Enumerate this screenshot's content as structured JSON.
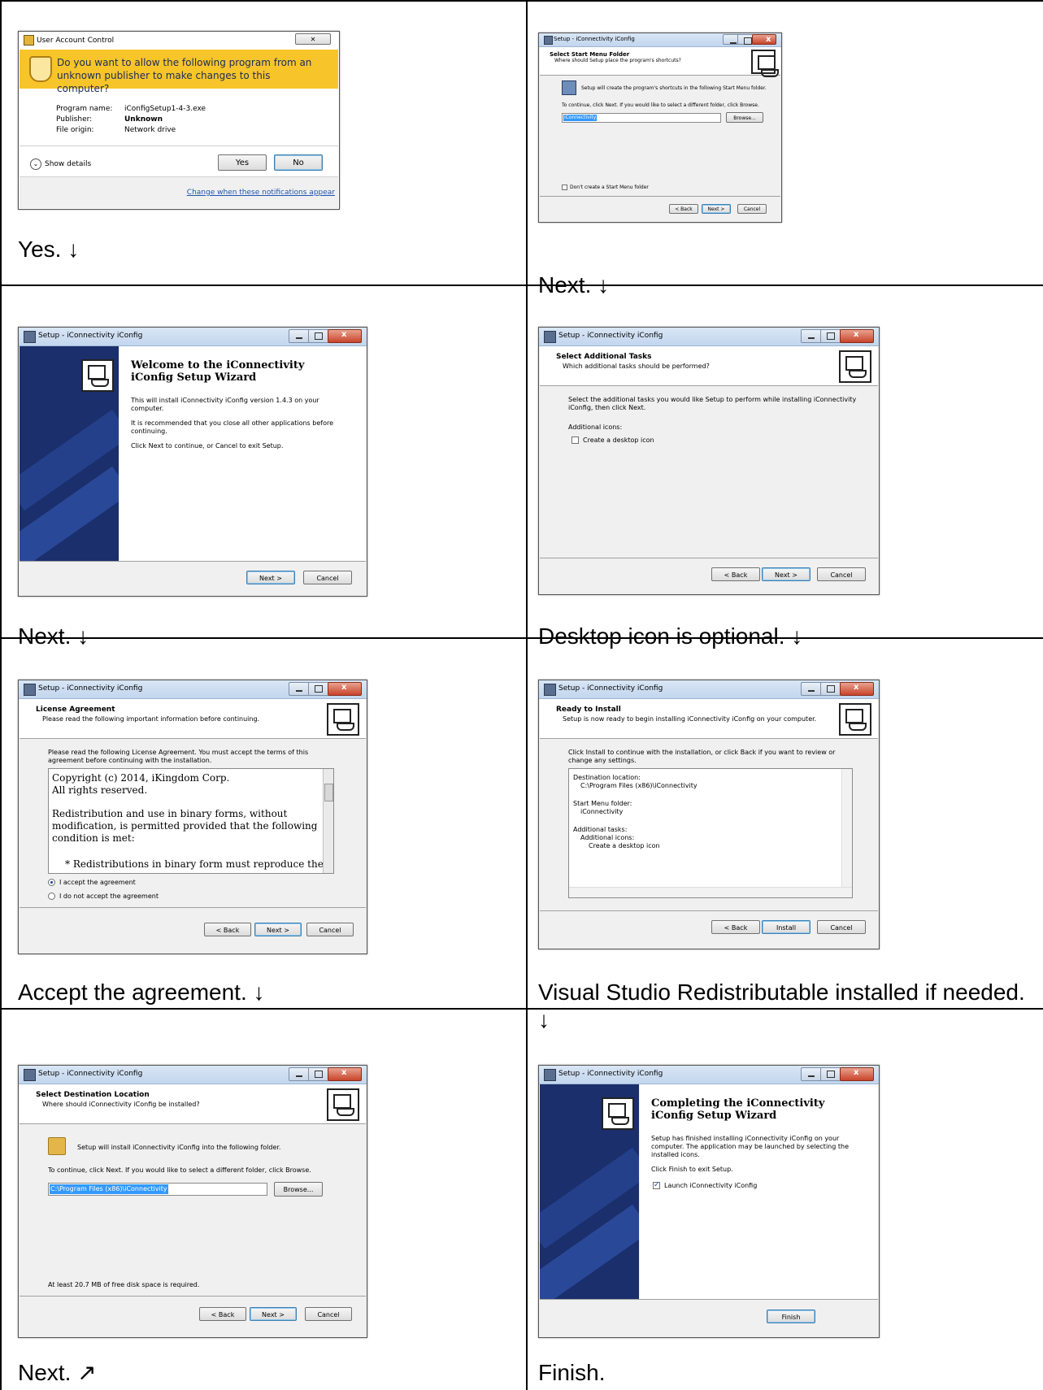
{
  "captions": {
    "c1": "Yes. ↓",
    "c2": "Next. ↓",
    "c3": "Next. ↓",
    "c4": "Desktop icon is optional. ↓",
    "c5": "Accept the agreement. ↓",
    "c6": "Visual Studio Redistributable installed if needed. ↓",
    "c7": "Next. ↗",
    "c8": "Finish."
  },
  "uac": {
    "title": "User Account Control",
    "question": "Do you want to allow the following program from an unknown publisher to make changes to this computer?",
    "program_label": "Program name:",
    "program_value": "iConfigSetup1-4-3.exe",
    "publisher_label": "Publisher:",
    "publisher_value": "Unknown",
    "origin_label": "File origin:",
    "origin_value": "Network drive",
    "show_details": "Show details",
    "yes": "Yes",
    "no": "No",
    "change_link": "Change when these notifications appear"
  },
  "window_title": "Setup - iConnectivity iConfig",
  "start_menu": {
    "title": "Select Start Menu Folder",
    "subtitle": "Where should Setup place the program's shortcuts?",
    "line1": "Setup will create the program's shortcuts in the following Start Menu folder.",
    "line2": "To continue, click Next. If you would like to select a different folder, click Browse.",
    "folder_value": "iConnectivity",
    "browse": "Browse...",
    "dont_create": "Don't create a Start Menu folder",
    "back": "< Back",
    "next": "Next >",
    "cancel": "Cancel"
  },
  "welcome": {
    "title": "Welcome to the iConnectivity iConfig Setup Wizard",
    "p1": "This will install iConnectivity iConfig version 1.4.3 on your computer.",
    "p2": "It is recommended that you close all other applications before continuing.",
    "p3": "Click Next to continue, or Cancel to exit Setup.",
    "next": "Next >",
    "cancel": "Cancel"
  },
  "tasks": {
    "title": "Select Additional Tasks",
    "subtitle": "Which additional tasks should be performed?",
    "p1": "Select the additional tasks you would like Setup to perform while installing iConnectivity iConfig, then click Next.",
    "additional": "Additional icons:",
    "desktop": "Create a desktop icon",
    "back": "< Back",
    "next": "Next >",
    "cancel": "Cancel"
  },
  "license": {
    "title": "License Agreement",
    "subtitle": "Please read the following important information before continuing.",
    "p1": "Please read the following License Agreement. You must accept the terms of this agreement before continuing with the installation.",
    "l1": "Copyright (c) 2014, iKingdom Corp.",
    "l2": "All rights reserved.",
    "l3": "Redistribution and use in binary forms, without",
    "l4": "modification, is permitted provided that the following",
    "l5": "condition is met:",
    "l6": "* Redistributions in binary form must reproduce the",
    "accept": "I accept the agreement",
    "decline": "I do not accept the agreement",
    "back": "< Back",
    "next": "Next >",
    "cancel": "Cancel"
  },
  "ready": {
    "title": "Ready to Install",
    "subtitle": "Setup is now ready to begin installing iConnectivity iConfig on your computer.",
    "p1": "Click Install to continue with the installation, or click Back if you want to review or change any settings.",
    "dest_label": "Destination location:",
    "dest_value": "C:\\Program Files (x86)\\iConnectivity",
    "menu_label": "Start Menu folder:",
    "menu_value": "iConnectivity",
    "tasks_label": "Additional tasks:",
    "tasks_sub": "Additional icons:",
    "tasks_value": "Create a desktop icon",
    "back": "< Back",
    "install": "Install",
    "cancel": "Cancel"
  },
  "destination": {
    "title": "Select Destination Location",
    "subtitle": "Where should iConnectivity iConfig be installed?",
    "line1": "Setup will install iConnectivity iConfig into the following folder.",
    "line2": "To continue, click Next. If you would like to select a different folder, click Browse.",
    "path": "C:\\Program Files (x86)\\iConnectivity",
    "browse": "Browse...",
    "space": "At least 20.7 MB of free disk space is required.",
    "back": "< Back",
    "next": "Next >",
    "cancel": "Cancel"
  },
  "completing": {
    "title": "Completing the iConnectivity iConfig Setup Wizard",
    "p1": "Setup has finished installing iConnectivity iConfig on your computer. The application may be launched by selecting the installed icons.",
    "p2": "Click Finish to exit Setup.",
    "launch": "Launch iConnectivity iConfig",
    "finish": "Finish"
  }
}
